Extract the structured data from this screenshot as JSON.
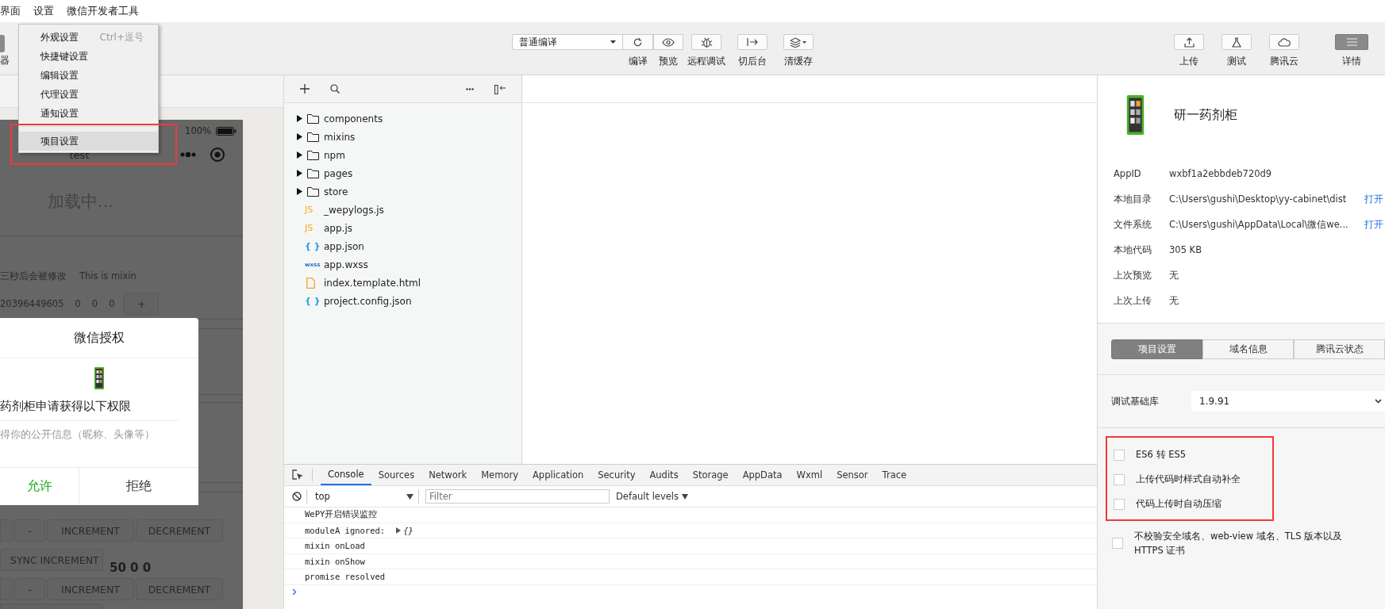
{
  "menu_bar": [
    {
      "label": "界面"
    },
    {
      "label": "设置"
    },
    {
      "label": "微信开发者工具"
    }
  ],
  "settings_menu": {
    "items": [
      {
        "label": "外观设置",
        "shortcut": "Ctrl+逗号",
        "selected": false,
        "separator_before": false,
        "highlighted": false
      },
      {
        "label": "快捷键设置",
        "selected": false,
        "separator_before": false,
        "highlighted": false
      },
      {
        "label": "编辑设置",
        "selected": false,
        "separator_before": false,
        "highlighted": false
      },
      {
        "label": "代理设置",
        "selected": false,
        "separator_before": false,
        "highlighted": false
      },
      {
        "label": "通知设置",
        "selected": false,
        "separator_before": false,
        "highlighted": false
      },
      {
        "label": "项目设置",
        "selected": true,
        "separator_before": true,
        "highlighted": true
      }
    ]
  },
  "toolbar": {
    "left_label": "器",
    "compile_mode": "普通编译",
    "center_buttons": [
      {
        "kind": "refresh",
        "label": "编译"
      },
      {
        "kind": "preview",
        "label": "预览"
      },
      {
        "kind": "debug",
        "label": "远程调试"
      },
      {
        "kind": "background",
        "label": "切后台"
      },
      {
        "kind": "cache",
        "label": "清缓存"
      }
    ],
    "right_buttons": [
      {
        "kind": "upload",
        "label": "上传",
        "selected": false
      },
      {
        "kind": "test",
        "label": "测试",
        "selected": false
      },
      {
        "kind": "cloud",
        "label": "腾讯云",
        "selected": false
      },
      {
        "kind": "details",
        "label": "详情",
        "selected": true
      }
    ]
  },
  "simulator": {
    "battery": "100%",
    "title": "test",
    "loading": "加载中...",
    "mixin_line": [
      "三秒后会被修改",
      "This is mixin"
    ],
    "counters": [
      "20396449605",
      "0",
      "0",
      "0"
    ],
    "plus": "+",
    "button_rows": [
      {
        "buttons": [
          "-",
          "INCREMENT",
          "DECREMENT"
        ]
      },
      {
        "buttons": [
          "SYNC INCREMENT"
        ],
        "value": "50 0 0"
      },
      {
        "buttons": [
          "-",
          "INCREMENT",
          "DECREMENT"
        ]
      }
    ],
    "dialog": {
      "title": "微信授权",
      "request": "药剂柜申请获得以下权限",
      "permission": "得你的公开信息（昵称、头像等）",
      "allow": "允许",
      "deny": "拒绝"
    }
  },
  "file_tree": [
    {
      "kind": "folder",
      "name": "components",
      "expanded": false
    },
    {
      "kind": "folder",
      "name": "mixins",
      "expanded": false
    },
    {
      "kind": "folder",
      "name": "npm",
      "expanded": false
    },
    {
      "kind": "folder",
      "name": "pages",
      "expanded": false
    },
    {
      "kind": "folder",
      "name": "store",
      "expanded": false
    },
    {
      "kind": "js",
      "name": "_wepylogs.js",
      "badge": "JS"
    },
    {
      "kind": "js",
      "name": "app.js",
      "badge": "JS"
    },
    {
      "kind": "json",
      "name": "app.json",
      "badge": "{ }"
    },
    {
      "kind": "wxss",
      "name": "app.wxss",
      "badge": "wxss"
    },
    {
      "kind": "html",
      "name": "index.template.html"
    },
    {
      "kind": "json",
      "name": "project.config.json",
      "badge": "{ }"
    }
  ],
  "console": {
    "tabs": [
      {
        "label": "Console",
        "selected": true
      },
      {
        "label": "Sources",
        "selected": false
      },
      {
        "label": "Network",
        "selected": false
      },
      {
        "label": "Memory",
        "selected": false
      },
      {
        "label": "Application",
        "selected": false
      },
      {
        "label": "Security",
        "selected": false
      },
      {
        "label": "Audits",
        "selected": false
      },
      {
        "label": "Storage",
        "selected": false
      },
      {
        "label": "AppData",
        "selected": false
      },
      {
        "label": "Wxml",
        "selected": false
      },
      {
        "label": "Sensor",
        "selected": false
      },
      {
        "label": "Trace",
        "selected": false
      }
    ],
    "context": "top",
    "filter_placeholder": "Filter",
    "levels": "Default levels",
    "lines": [
      {
        "text": "WePY开启错误监控"
      },
      {
        "text": "moduleA ignored:",
        "object": "{}"
      },
      {
        "text": "mixin onLoad"
      },
      {
        "text": "mixin onShow"
      },
      {
        "text": "promise resolved"
      }
    ]
  },
  "details": {
    "app_name": "研一药剂柜",
    "info": [
      {
        "label": "AppID",
        "value": "wxbf1a2ebbdeb720d9"
      },
      {
        "label": "本地目录",
        "value": "C:\\Users\\gushi\\Desktop\\yy-cabinet\\dist",
        "action": "打开"
      },
      {
        "label": "文件系统",
        "value": "C:\\Users\\gushi\\AppData\\Local\\微信we...",
        "action": "打开"
      },
      {
        "label": "本地代码",
        "value": "305 KB"
      },
      {
        "label": "上次预览",
        "value": "无"
      },
      {
        "label": "上次上传",
        "value": "无"
      }
    ],
    "tabs": [
      {
        "label": "项目设置",
        "selected": true
      },
      {
        "label": "域名信息",
        "selected": false
      },
      {
        "label": "腾讯云状态",
        "selected": false
      }
    ],
    "base_library": {
      "label": "调试基础库",
      "value": "1.9.91"
    },
    "option_groups": [
      {
        "highlighted": true,
        "options": [
          {
            "label": "ES6 转 ES5",
            "checked": false
          },
          {
            "label": "上传代码时样式自动补全",
            "checked": false
          },
          {
            "label": "代码上传时自动压缩",
            "checked": false
          }
        ]
      },
      {
        "highlighted": false,
        "options": [
          {
            "label": "不校验安全域名、web-view 域名、TLS 版本以及 HTTPS 证书",
            "checked": false
          }
        ]
      }
    ]
  }
}
